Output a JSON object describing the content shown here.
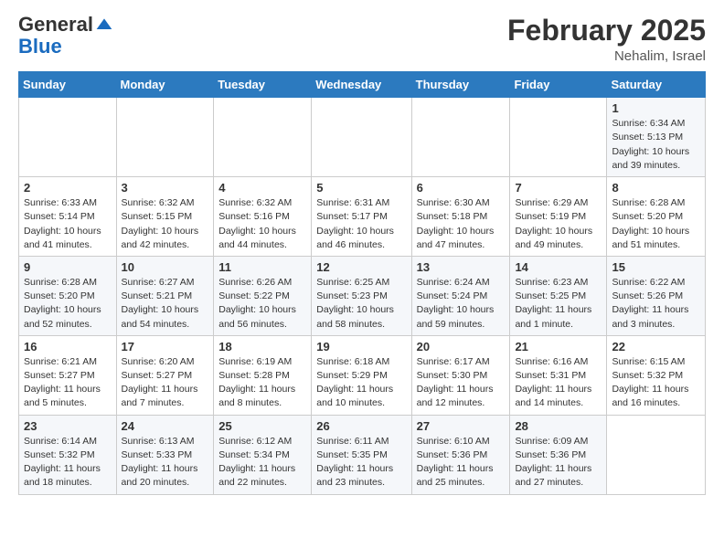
{
  "header": {
    "logo_general": "General",
    "logo_blue": "Blue",
    "month_title": "February 2025",
    "location": "Nehalim, Israel"
  },
  "days_of_week": [
    "Sunday",
    "Monday",
    "Tuesday",
    "Wednesday",
    "Thursday",
    "Friday",
    "Saturday"
  ],
  "weeks": [
    [
      {
        "day": "",
        "info": ""
      },
      {
        "day": "",
        "info": ""
      },
      {
        "day": "",
        "info": ""
      },
      {
        "day": "",
        "info": ""
      },
      {
        "day": "",
        "info": ""
      },
      {
        "day": "",
        "info": ""
      },
      {
        "day": "1",
        "info": "Sunrise: 6:34 AM\nSunset: 5:13 PM\nDaylight: 10 hours\nand 39 minutes."
      }
    ],
    [
      {
        "day": "2",
        "info": "Sunrise: 6:33 AM\nSunset: 5:14 PM\nDaylight: 10 hours\nand 41 minutes."
      },
      {
        "day": "3",
        "info": "Sunrise: 6:32 AM\nSunset: 5:15 PM\nDaylight: 10 hours\nand 42 minutes."
      },
      {
        "day": "4",
        "info": "Sunrise: 6:32 AM\nSunset: 5:16 PM\nDaylight: 10 hours\nand 44 minutes."
      },
      {
        "day": "5",
        "info": "Sunrise: 6:31 AM\nSunset: 5:17 PM\nDaylight: 10 hours\nand 46 minutes."
      },
      {
        "day": "6",
        "info": "Sunrise: 6:30 AM\nSunset: 5:18 PM\nDaylight: 10 hours\nand 47 minutes."
      },
      {
        "day": "7",
        "info": "Sunrise: 6:29 AM\nSunset: 5:19 PM\nDaylight: 10 hours\nand 49 minutes."
      },
      {
        "day": "8",
        "info": "Sunrise: 6:28 AM\nSunset: 5:20 PM\nDaylight: 10 hours\nand 51 minutes."
      }
    ],
    [
      {
        "day": "9",
        "info": "Sunrise: 6:28 AM\nSunset: 5:20 PM\nDaylight: 10 hours\nand 52 minutes."
      },
      {
        "day": "10",
        "info": "Sunrise: 6:27 AM\nSunset: 5:21 PM\nDaylight: 10 hours\nand 54 minutes."
      },
      {
        "day": "11",
        "info": "Sunrise: 6:26 AM\nSunset: 5:22 PM\nDaylight: 10 hours\nand 56 minutes."
      },
      {
        "day": "12",
        "info": "Sunrise: 6:25 AM\nSunset: 5:23 PM\nDaylight: 10 hours\nand 58 minutes."
      },
      {
        "day": "13",
        "info": "Sunrise: 6:24 AM\nSunset: 5:24 PM\nDaylight: 10 hours\nand 59 minutes."
      },
      {
        "day": "14",
        "info": "Sunrise: 6:23 AM\nSunset: 5:25 PM\nDaylight: 11 hours\nand 1 minute."
      },
      {
        "day": "15",
        "info": "Sunrise: 6:22 AM\nSunset: 5:26 PM\nDaylight: 11 hours\nand 3 minutes."
      }
    ],
    [
      {
        "day": "16",
        "info": "Sunrise: 6:21 AM\nSunset: 5:27 PM\nDaylight: 11 hours\nand 5 minutes."
      },
      {
        "day": "17",
        "info": "Sunrise: 6:20 AM\nSunset: 5:27 PM\nDaylight: 11 hours\nand 7 minutes."
      },
      {
        "day": "18",
        "info": "Sunrise: 6:19 AM\nSunset: 5:28 PM\nDaylight: 11 hours\nand 8 minutes."
      },
      {
        "day": "19",
        "info": "Sunrise: 6:18 AM\nSunset: 5:29 PM\nDaylight: 11 hours\nand 10 minutes."
      },
      {
        "day": "20",
        "info": "Sunrise: 6:17 AM\nSunset: 5:30 PM\nDaylight: 11 hours\nand 12 minutes."
      },
      {
        "day": "21",
        "info": "Sunrise: 6:16 AM\nSunset: 5:31 PM\nDaylight: 11 hours\nand 14 minutes."
      },
      {
        "day": "22",
        "info": "Sunrise: 6:15 AM\nSunset: 5:32 PM\nDaylight: 11 hours\nand 16 minutes."
      }
    ],
    [
      {
        "day": "23",
        "info": "Sunrise: 6:14 AM\nSunset: 5:32 PM\nDaylight: 11 hours\nand 18 minutes."
      },
      {
        "day": "24",
        "info": "Sunrise: 6:13 AM\nSunset: 5:33 PM\nDaylight: 11 hours\nand 20 minutes."
      },
      {
        "day": "25",
        "info": "Sunrise: 6:12 AM\nSunset: 5:34 PM\nDaylight: 11 hours\nand 22 minutes."
      },
      {
        "day": "26",
        "info": "Sunrise: 6:11 AM\nSunset: 5:35 PM\nDaylight: 11 hours\nand 23 minutes."
      },
      {
        "day": "27",
        "info": "Sunrise: 6:10 AM\nSunset: 5:36 PM\nDaylight: 11 hours\nand 25 minutes."
      },
      {
        "day": "28",
        "info": "Sunrise: 6:09 AM\nSunset: 5:36 PM\nDaylight: 11 hours\nand 27 minutes."
      },
      {
        "day": "",
        "info": ""
      }
    ]
  ]
}
